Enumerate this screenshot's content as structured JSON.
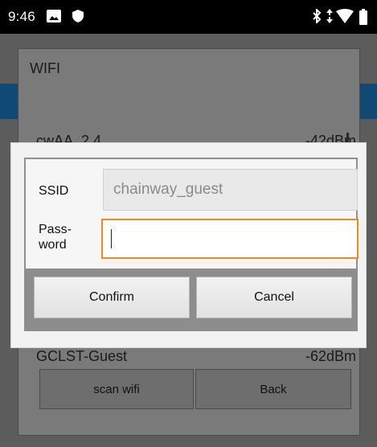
{
  "status_bar": {
    "time": "9:46",
    "icons": [
      "image-icon",
      "shield-icon",
      "bluetooth-icon",
      "data-arrows-icon",
      "wifi-signal-icon",
      "battery-icon"
    ]
  },
  "wifi_screen": {
    "title": "WIFI",
    "networks": [
      {
        "ssid": "cwAA_2.4",
        "signal": "-42dBm"
      },
      {
        "ssid": "GCLST-Guest",
        "signal": "-62dBm"
      }
    ],
    "scan_button": "scan wifi",
    "back_button": "Back"
  },
  "dialog": {
    "ssid_label": "SSID",
    "ssid_value": "chainway_guest",
    "password_label_line1": "Pass-",
    "password_label_line2": "word",
    "password_value": "",
    "confirm_button": "Confirm",
    "cancel_button": "Cancel"
  },
  "colors": {
    "accent_focus": "#f08a1c",
    "dim_overlay": "#5c5c5c",
    "blue_strip": "#104a74"
  }
}
